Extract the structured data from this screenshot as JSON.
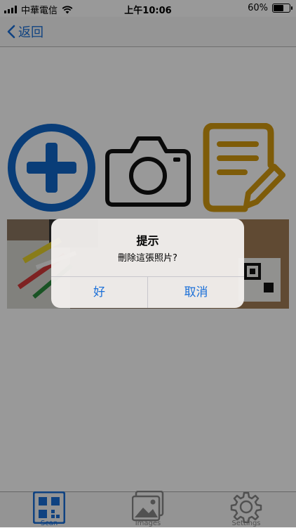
{
  "status_bar": {
    "carrier": "中華電信",
    "time": "上午10:06",
    "battery_percent": "60%",
    "battery_level": 0.6
  },
  "nav": {
    "back_label": "返回"
  },
  "actions": {
    "add_icon": "plus-circle-icon",
    "camera_icon": "camera-icon",
    "note_icon": "note-edit-icon",
    "colors": {
      "add": "#0f66c8",
      "camera": "#111111",
      "note": "#d39a10"
    }
  },
  "photo": {
    "description_icon": "photo-thumbnail"
  },
  "alert": {
    "title": "提示",
    "message": "刪除這張照片?",
    "ok_label": "好",
    "cancel_label": "取消"
  },
  "tabs": [
    {
      "label": "Scan",
      "icon": "qr-code-icon",
      "active": true
    },
    {
      "label": "Images",
      "icon": "images-icon",
      "active": false
    },
    {
      "label": "Settings",
      "icon": "gear-icon",
      "active": false
    }
  ],
  "colors": {
    "accent": "#1a6fd8"
  }
}
